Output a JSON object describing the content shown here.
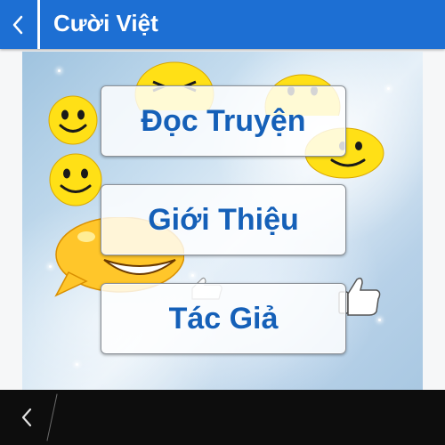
{
  "app": {
    "title": "Cười Việt"
  },
  "menu": {
    "items": [
      {
        "label": "Đọc Truyện"
      },
      {
        "label": "Giới Thiệu"
      },
      {
        "label": "Tác Giả"
      }
    ]
  },
  "icons": {
    "appbar_back": "chevron-left-icon",
    "system_back": "chevron-left-icon"
  },
  "colors": {
    "appbar": "#1d6fd3",
    "button_text": "#1560b8",
    "navbar": "#0d0d0d",
    "smiley": "#ffe016"
  }
}
